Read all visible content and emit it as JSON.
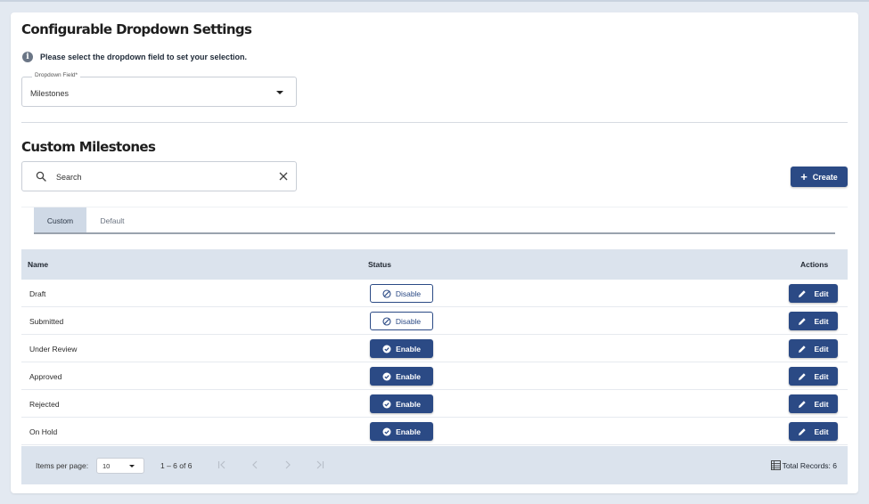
{
  "page": {
    "title": "Configurable Dropdown Settings"
  },
  "info": {
    "text": "Please select the dropdown field to set your selection."
  },
  "dropdown": {
    "label": "Dropdown Field*",
    "value": "Milestones"
  },
  "section": {
    "title": "Custom Milestones"
  },
  "search": {
    "placeholder": "Search"
  },
  "create_button": {
    "label": "Create"
  },
  "tabs": [
    {
      "label": "Custom",
      "active": true
    },
    {
      "label": "Default",
      "active": false
    }
  ],
  "table": {
    "headers": {
      "name": "Name",
      "status": "Status",
      "actions": "Actions"
    },
    "rows": [
      {
        "name": "Draft",
        "status_label": "Disable",
        "action_label": "Edit"
      },
      {
        "name": "Submitted",
        "status_label": "Disable",
        "action_label": "Edit"
      },
      {
        "name": "Under Review",
        "status_label": "Enable",
        "action_label": "Edit"
      },
      {
        "name": "Approved",
        "status_label": "Enable",
        "action_label": "Edit"
      },
      {
        "name": "Rejected",
        "status_label": "Enable",
        "action_label": "Edit"
      },
      {
        "name": "On Hold",
        "status_label": "Enable",
        "action_label": "Edit"
      }
    ]
  },
  "pagination": {
    "items_per_page_label": "Items per page:",
    "items_per_page": "10",
    "range": "1 – 6 of 6",
    "total_records": "Total Records: 6"
  },
  "icons": {
    "info": "info-icon",
    "search": "search-icon",
    "clear": "close-icon",
    "create": "plus-icon",
    "disable": "block-icon",
    "enable": "check-circle-icon",
    "edit": "pencil-icon",
    "first_page": "first-page-icon",
    "prev_page": "chevron-left-icon",
    "next_page": "chevron-right-icon",
    "last_page": "last-page-icon",
    "total": "table-icon"
  },
  "colors": {
    "primary": "#2b4a85",
    "header_bg": "#dbe3ed",
    "page_bg": "#e3e9f1"
  }
}
